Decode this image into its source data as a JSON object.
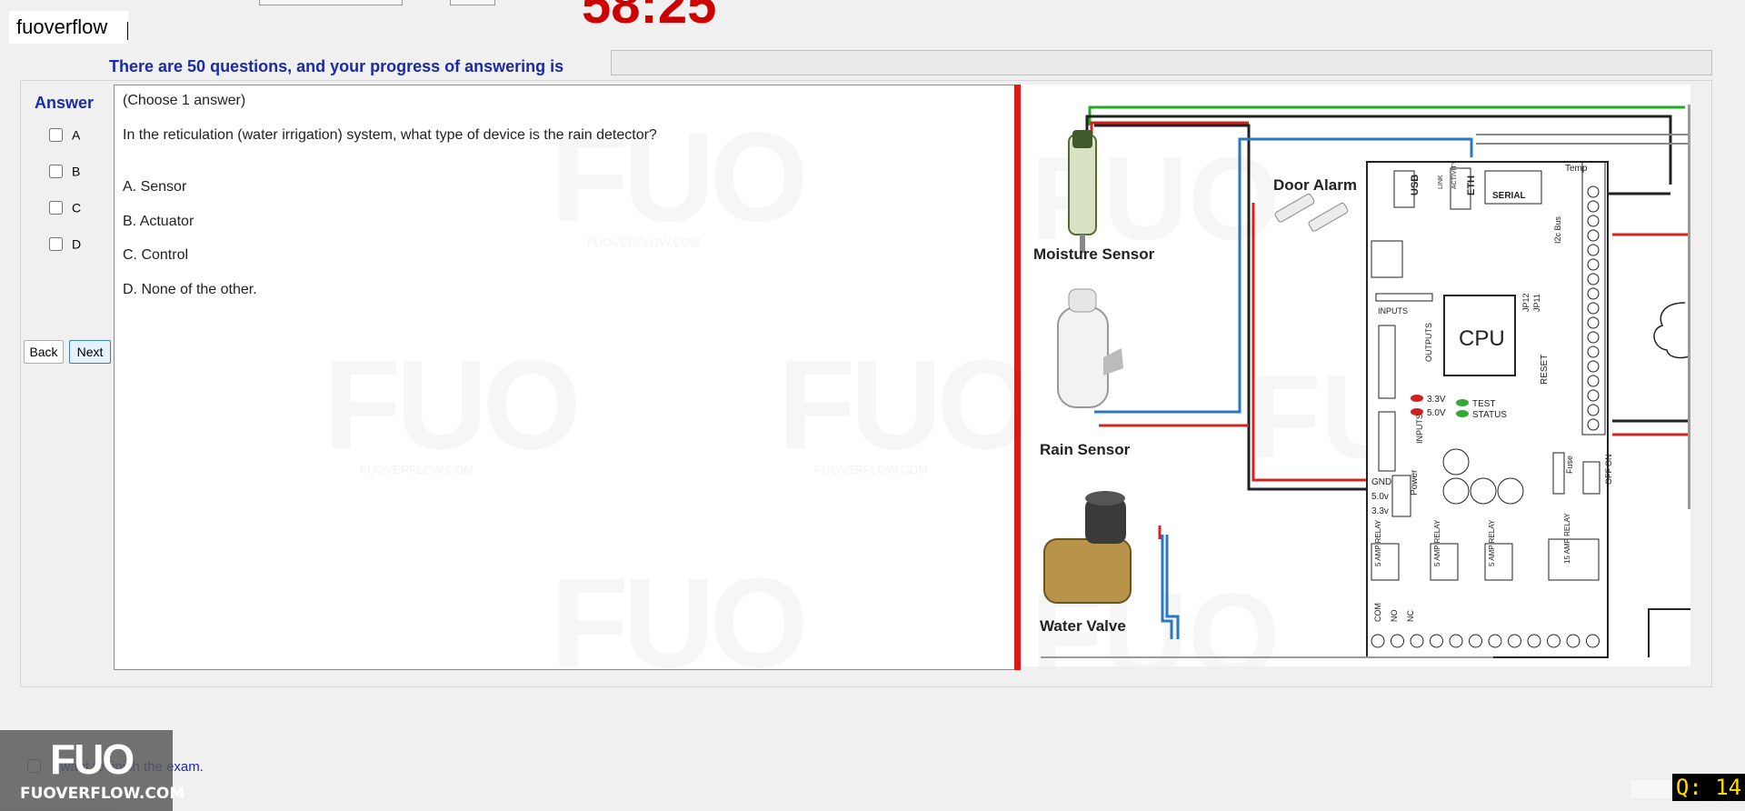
{
  "brand": {
    "text": "fuoverflow"
  },
  "timer": {
    "text": "58:25"
  },
  "progress": {
    "label": "There are 50 questions, and your progress of answering is",
    "fraction": 0
  },
  "answer_panel": {
    "title": "Answer",
    "options": [
      "A",
      "B",
      "C",
      "D"
    ]
  },
  "nav": {
    "back_label": "Back",
    "next_label": "Next"
  },
  "question": {
    "instruction": "(Choose 1 answer)",
    "text": "In the reticulation  (water irrigation) system, what type of device is the rain detector?",
    "answers": [
      {
        "letter": "A.",
        "text": "Sensor"
      },
      {
        "letter": "B.",
        "text": "Actuator"
      },
      {
        "letter": "C.",
        "text": "Control"
      },
      {
        "letter": "D.",
        "text": "None of the other."
      }
    ]
  },
  "diagram": {
    "labels": {
      "moisture": "Moisture Sensor",
      "rain": "Rain Sensor",
      "valve": "Water Valve",
      "door": "Door Alarm",
      "cpu": "CPU",
      "usb": "USB",
      "eth": "ETH",
      "serial": "SERIAL",
      "temp": "Temp",
      "inputs": "INPUTS",
      "outputs": "OUTPUTS",
      "reset": "RESET",
      "test": "TEST",
      "status": "STATUS",
      "v33": "3.3V",
      "v50": "5.0V",
      "power": "Power",
      "gnd": "GND",
      "p50": "5.0v",
      "p33": "3.3v",
      "fuse": "Fuse",
      "on": "ON",
      "off": "OFF",
      "relay5": "5 AMP RELAY",
      "relay15": "15 AMP RELAY",
      "com": "COM",
      "no": "NO",
      "nc": "NC",
      "jp12": "JP12",
      "jp11": "JP11",
      "i2c": "I2c Bus",
      "link": "LINK",
      "activity": "ACTIVITY"
    }
  },
  "watermarks": {
    "big": "FUO",
    "small": "FUOVERFLOW.COM"
  },
  "footer": {
    "finish_label": "I want to finish the exam.",
    "logo_big": "FUO",
    "logo_small": "FUOVERFLOW.COM",
    "question_badge": "Q: 14"
  },
  "colors": {
    "accent_blue": "#1a2aa8",
    "timer_red": "#cc0000",
    "divider_red": "#d71b1b",
    "badge_yellow": "#ffde00"
  }
}
